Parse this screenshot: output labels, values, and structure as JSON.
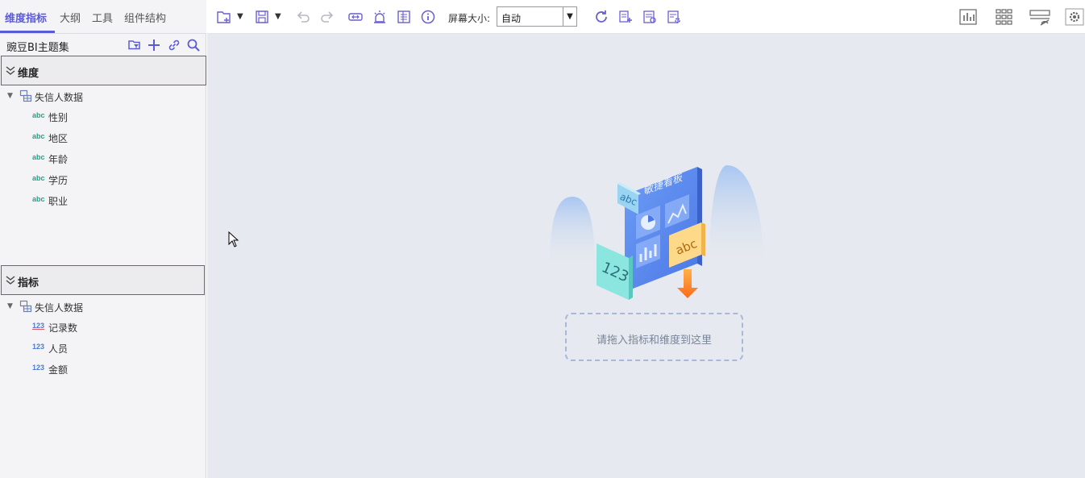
{
  "left_panel": {
    "tabs": [
      "维度指标",
      "大纲",
      "工具",
      "组件结构"
    ],
    "active_tab": "维度指标",
    "theme_title": "豌豆BI主题集",
    "toolbar_icons": [
      "folder-filter-icon",
      "plus-icon",
      "link-icon",
      "search-icon"
    ],
    "dimensions": {
      "title": "维度",
      "table_name": "失信人数据",
      "fields": [
        {
          "badge": "abc",
          "label": "性别"
        },
        {
          "badge": "abc",
          "label": "地区"
        },
        {
          "badge": "abc",
          "label": "年龄"
        },
        {
          "badge": "abc",
          "label": "学历"
        },
        {
          "badge": "abc",
          "label": "职业"
        }
      ]
    },
    "measures": {
      "title": "指标",
      "table_name": "失信人数据",
      "fields": [
        {
          "badge": "123",
          "label": "记录数"
        },
        {
          "badge": "123",
          "label": "人员"
        },
        {
          "badge": "123",
          "label": "金额"
        }
      ]
    }
  },
  "toolbar": {
    "screen_size_label": "屏幕大小:",
    "screen_size_value": "自动",
    "icons": [
      "new-page-icon",
      "save-icon",
      "undo-icon",
      "redo-icon",
      "link-icon",
      "alarm-icon",
      "report-icon",
      "info-icon",
      "refresh-icon",
      "add-dataset-icon",
      "dataset-icon",
      "settings-icon"
    ],
    "right_icons": [
      "chart-icon",
      "grid-icon",
      "hide-icon",
      "gear-icon"
    ]
  },
  "canvas": {
    "illustration": {
      "board_title": "敏捷看板",
      "card_abc_small": "abc",
      "card_123": "123",
      "card_abc_large": "abc"
    },
    "drop_hint": "请拖入指标和维度到这里"
  },
  "colors": {
    "accent": "#5b5bd6",
    "highlight_border": "#d9363e",
    "canvas_bg": "#e6e9ef",
    "abc_badge": "#1ba784",
    "num_badge": "#4a7bd8"
  }
}
